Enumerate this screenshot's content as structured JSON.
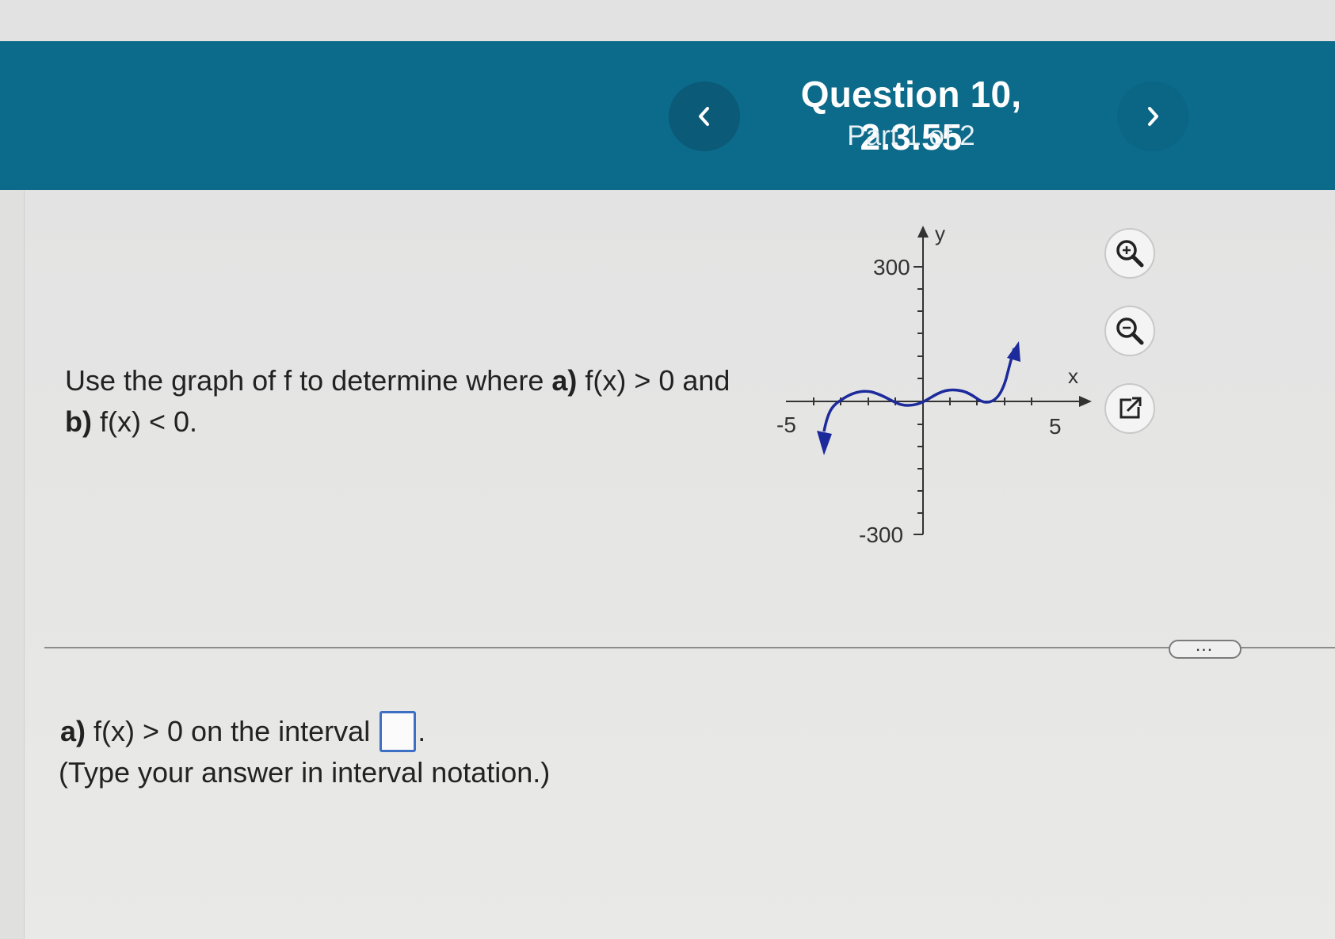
{
  "header": {
    "title": "Question 10, 2.3.55",
    "part": "Part 1 of 2"
  },
  "question": {
    "line1_prefix": "Use the graph of f to determine where ",
    "line1_a": "a)",
    "line1_mid": " f(x) > 0 and",
    "line2_b": "b)",
    "line2_rest": " f(x) < 0."
  },
  "graph": {
    "y_axis_label": "y",
    "x_axis_label": "x",
    "y_max_label": "300",
    "y_min_label": "-300",
    "x_min_label": "-5",
    "x_max_label": "5",
    "curve_color": "#1c2a9c"
  },
  "tools": {
    "zoom_in": "zoom-in-icon",
    "zoom_out": "zoom-out-icon",
    "popout": "external-link-icon"
  },
  "answer": {
    "label": "a)",
    "text": "f(x) > 0 on the interval",
    "period": ".",
    "hint": "(Type your answer in interval notation.)"
  },
  "more_button": "..."
}
